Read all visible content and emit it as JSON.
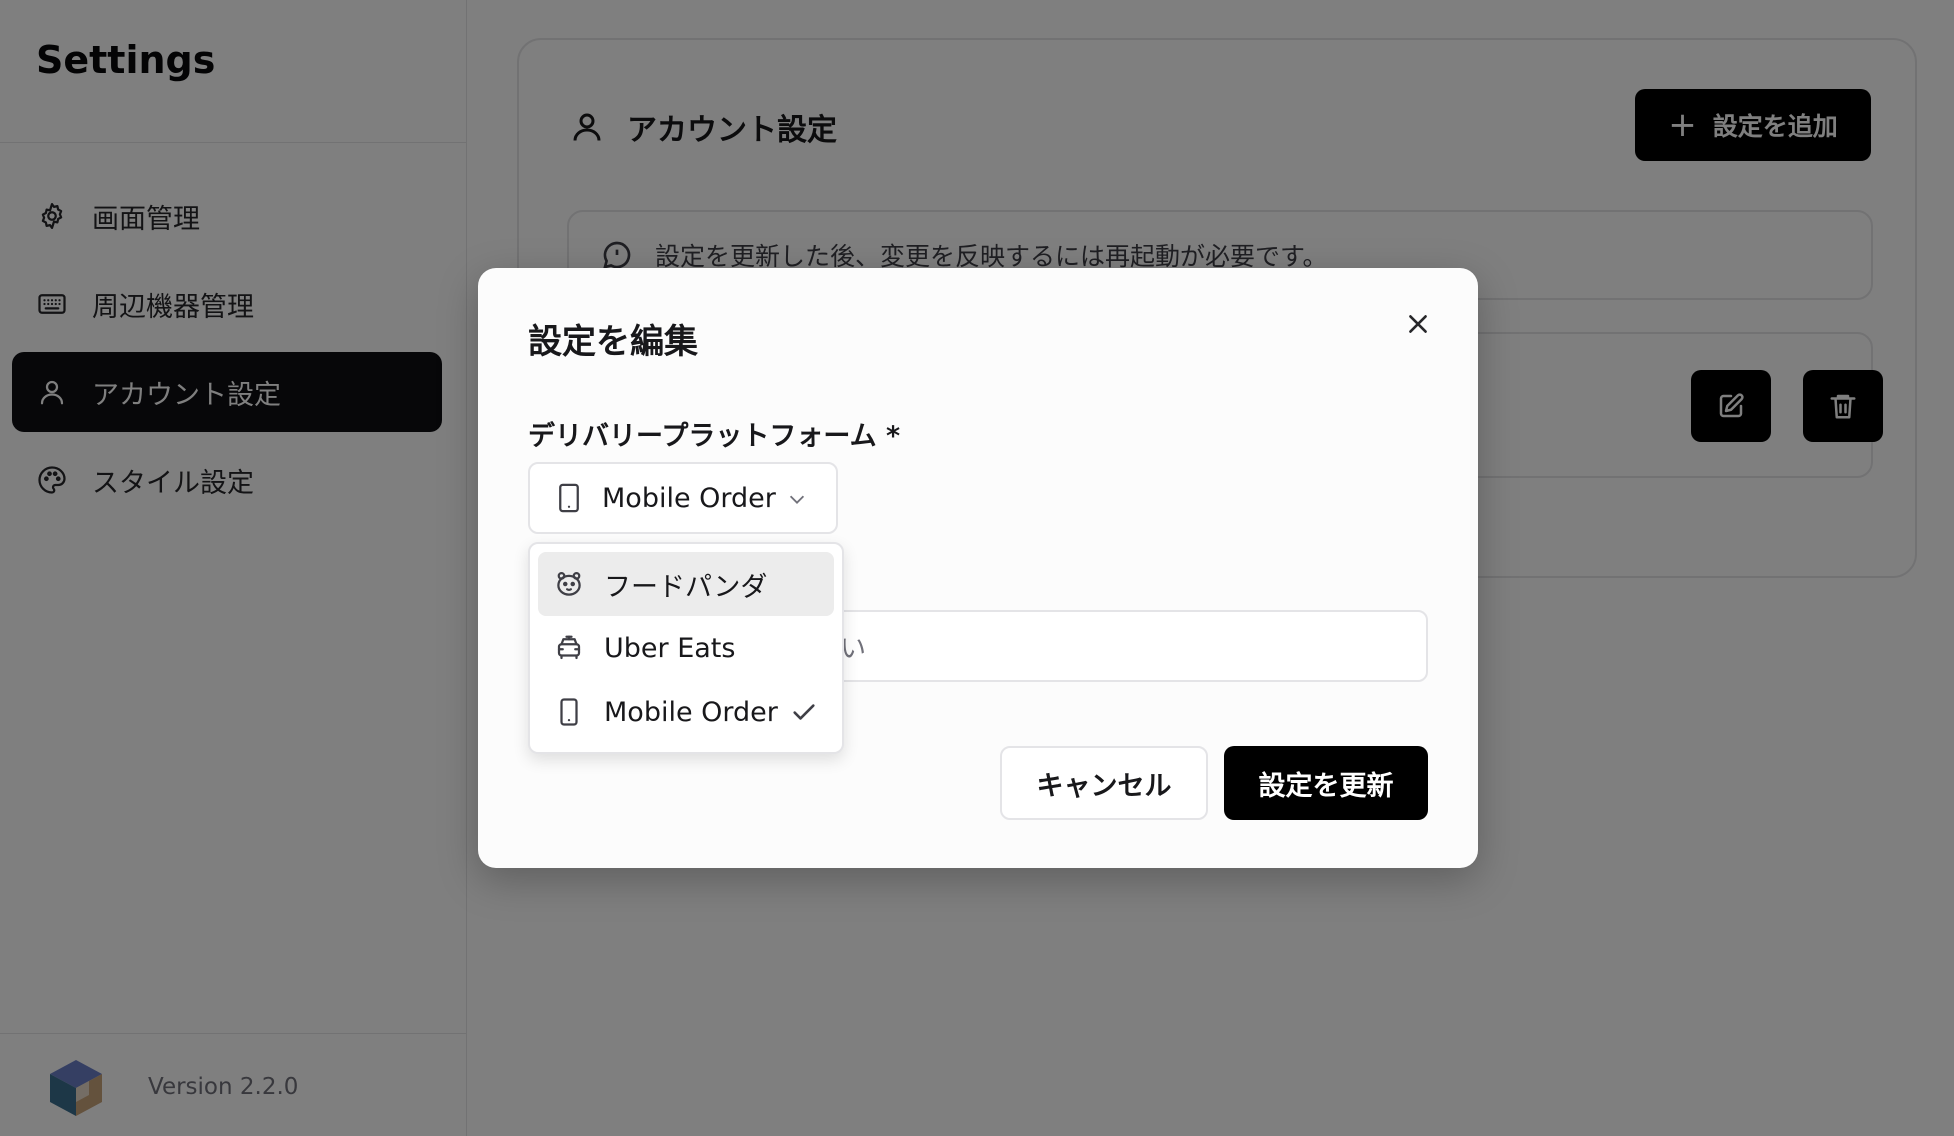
{
  "sidebar": {
    "title": "Settings",
    "items": [
      {
        "label": "画面管理",
        "icon": "gear-icon"
      },
      {
        "label": "周辺機器管理",
        "icon": "keyboard-icon"
      },
      {
        "label": "アカウント設定",
        "icon": "user-icon",
        "active": true
      },
      {
        "label": "スタイル設定",
        "icon": "palette-icon"
      }
    ],
    "version": "Version 2.2.0"
  },
  "main": {
    "card_title": "アカウント設定",
    "add_button_label": "設定を追加",
    "notice_text": "設定を更新した後、変更を反映するには再起動が必要です。"
  },
  "modal": {
    "title": "設定を編集",
    "platform_label": "デリバリープラットフォーム *",
    "selected_platform": "Mobile Order",
    "input_visible_text": "さい",
    "cancel_label": "キャンセル",
    "update_label": "設定を更新"
  },
  "dropdown": {
    "options": [
      {
        "label": "フードパンダ",
        "icon": "panda-icon",
        "highlighted": true
      },
      {
        "label": "Uber Eats",
        "icon": "car-icon"
      },
      {
        "label": "Mobile Order",
        "icon": "smartphone-icon",
        "selected": true
      }
    ]
  },
  "colors": {
    "accent": "#000000",
    "overlay": "rgba(0,0,0,0.5)",
    "border": "#e4e4e7"
  }
}
